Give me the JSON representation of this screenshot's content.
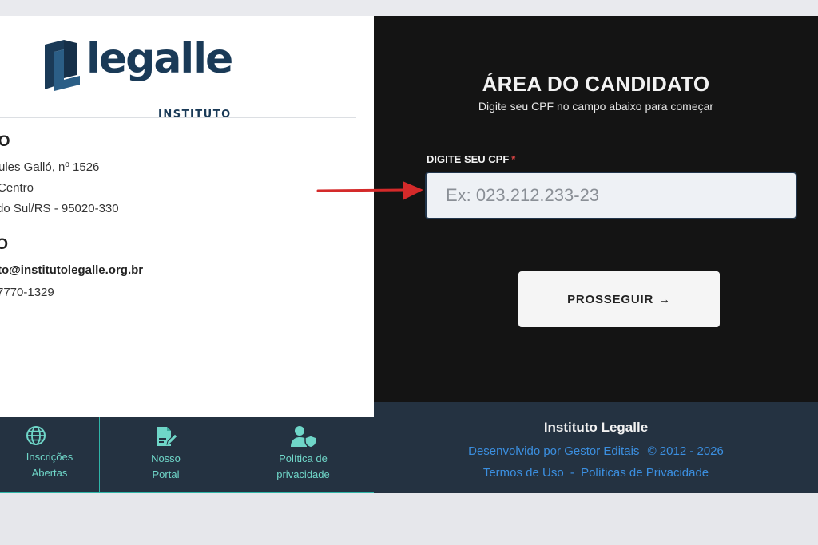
{
  "brand": {
    "name": "legalle",
    "subtitle": "INSTITUTO"
  },
  "address": {
    "title": "ÇO",
    "lines": [
      "ules Galló, nº 1526",
      "Centro",
      "do Sul/RS - 95020-330"
    ]
  },
  "contact": {
    "title": "TO",
    "email": "to@institutolegalle.org.br",
    "phone": "7770-1329"
  },
  "nav": {
    "items": [
      {
        "label": "Inscrições\nAbertas",
        "icon": "globe-icon"
      },
      {
        "label": "Nosso\nPortal",
        "icon": "portal-edit-icon"
      },
      {
        "label": "Política de\nprivacidade",
        "icon": "user-shield-icon"
      }
    ]
  },
  "candidate": {
    "title": "ÁREA DO CANDIDATO",
    "subtitle": "Digite seu CPF no campo abaixo para começar",
    "cpf_label": "DIGITE SEU CPF",
    "cpf_required": "*",
    "cpf_placeholder": "Ex: 023.212.233-23",
    "cpf_value": "",
    "proceed_label": "PROSSEGUIR",
    "proceed_arrow": "→"
  },
  "footer": {
    "title": "Instituto Legalle",
    "developed": "Desenvolvido por Gestor Editais",
    "copyright": "© 2012 - 2026",
    "terms": "Termos de Uso",
    "separator": "-",
    "privacy": "Políticas de Privacidade"
  },
  "colors": {
    "brand_navy": "#1a3a57",
    "nav_bg": "#243241",
    "nav_accent": "#2fb5a8",
    "panel_dark": "#141414",
    "link_blue": "#3b8fe0",
    "annotation_red": "#d42a2a"
  }
}
